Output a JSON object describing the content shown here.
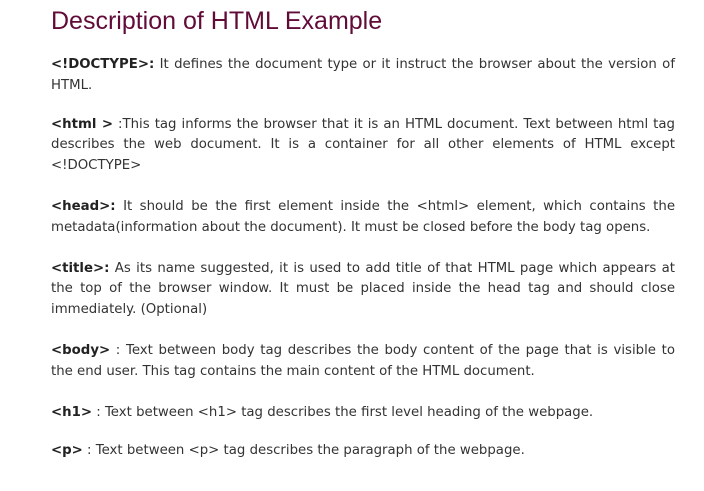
{
  "title": "Description of HTML Example",
  "items": [
    {
      "tag": "<!DOCTYPE>:",
      "text": " It defines the document type or it instruct the browser about the version of HTML."
    },
    {
      "tag": "<html >",
      "text": " :This tag informs the browser that it is an HTML document. Text between html tag describes the web document. It is a container for all other elements of HTML except <!DOCTYPE>"
    },
    {
      "tag": "<head>:",
      "text": " It should be the first element inside the <html> element, which contains the metadata(information about the document). It must be closed before the body tag opens."
    },
    {
      "tag": "<title>:",
      "text": " As its name suggested, it is used to add title of that HTML page which appears at the top of the browser window. It must be placed inside the head tag and should close immediately. (Optional)"
    },
    {
      "tag": "<body>",
      "text": " : Text between body tag describes the body content of the page that is visible to the end user. This tag contains the main content of the HTML document."
    },
    {
      "tag": "<h1>",
      "text": " : Text between <h1> tag describes the first level heading of the webpage."
    },
    {
      "tag": "<p>",
      "text": " : Text between <p> tag describes the paragraph of the webpage."
    }
  ]
}
